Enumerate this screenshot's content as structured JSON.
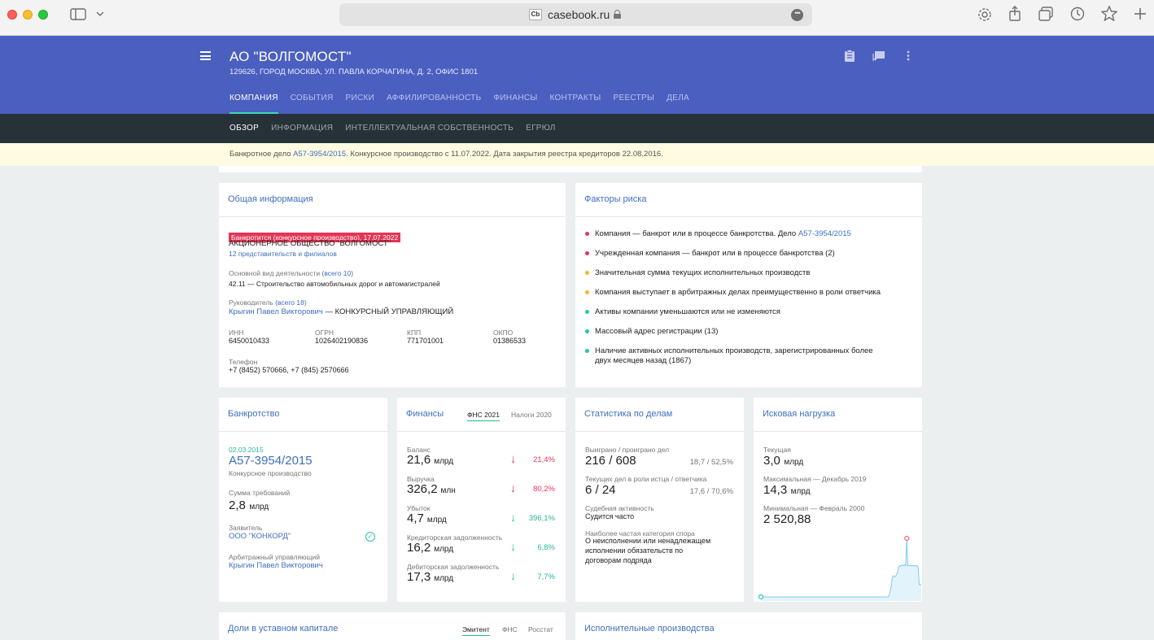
{
  "browser": {
    "url": "casebook.ru",
    "favicon_text": "Cb"
  },
  "company": {
    "name": "АО \"ВОЛГОМОСТ\"",
    "address": "129626, ГОРОД МОСКВА, УЛ. ПАВЛА КОРЧАГИНА, Д. 2, ОФИС 1801"
  },
  "main_tabs": [
    "КОМПАНИЯ",
    "СОБЫТИЯ",
    "РИСКИ",
    "АФФИЛИРОВАННОСТЬ",
    "ФИНАНСЫ",
    "КОНТРАКТЫ",
    "РЕЕСТРЫ",
    "ДЕЛА"
  ],
  "sub_tabs": [
    "ОБЗОР",
    "ИНФОРМАЦИЯ",
    "ИНТЕЛЛЕКТУАЛЬНАЯ СОБСТВЕННОСТЬ",
    "ЕГРЮЛ"
  ],
  "banner": {
    "prefix": "Банкротное дело ",
    "case_link": "А57-3954/2015",
    "suffix": ". Конкурсное производство с 11.07.2022. Дата закрытия реестра кредиторов 22.08.2016."
  },
  "general": {
    "title": "Общая информация",
    "badge": "Банкротится (конкурсное производство), 17.07.2022",
    "full_name": "АКЦИОНЕРНОЕ ОБЩЕСТВО \"ВОЛГОМОСТ\"",
    "branches": "12 представительств и филиалов",
    "activity_label": "Основной вид деятельности",
    "activity_total": "(всего 10)",
    "activity_value": "42.11 — Строительство автомобильных дорог и автомагистралей",
    "head_label": "Руководитель",
    "head_total": "(всего 18)",
    "head_name": "Крыгин Павел Викторович",
    "head_role": " — КОНКУРСНЫЙ УПРАВЛЯЮЩИЙ",
    "ids": [
      {
        "label": "ИНН",
        "value": "6450010433"
      },
      {
        "label": "ОГРН",
        "value": "1026402190836"
      },
      {
        "label": "КПП",
        "value": "771701001"
      },
      {
        "label": "ОКПО",
        "value": "01386533"
      }
    ],
    "phone_label": "Телефон",
    "phone_value": "+7 (8452) 570666, +7 (845) 2570666"
  },
  "risks": {
    "title": "Факторы риска",
    "items": [
      {
        "text": "Компания — банкрот или в процессе банкротства. Дело ",
        "link": "А57-3954/2015",
        "color": "#e53555"
      },
      {
        "text": "Учрежденная компания — банкрот или в процессе банкротства (2)",
        "link": "",
        "color": "#e53555"
      },
      {
        "text": "Значительная сумма текущих исполнительных производств",
        "link": "",
        "color": "#f5b72a"
      },
      {
        "text": "Компания выступает в арбитражных делах преимущественно в роли ответчика",
        "link": "",
        "color": "#f5b72a"
      },
      {
        "text": "Активы компании уменьшаются или не изменяются",
        "link": "",
        "color": "#26c6a6"
      },
      {
        "text": "Массовый адрес регистрации (13)",
        "link": "",
        "color": "#26c6a6"
      },
      {
        "text": "Наличие активных исполнительных производств, зарегистрированных более",
        "text2": "двух месяцев назад (1867)",
        "link": "",
        "color": "#26c6a6"
      }
    ]
  },
  "bankruptcy": {
    "title": "Банкротство",
    "date": "02.03.2015",
    "case": "А57-3954/2015",
    "proc": "Конкурсное производство",
    "claims_label": "Сумма требований",
    "claims_value": "2,8",
    "claims_unit": "млрд",
    "applicant_label": "Заявитель",
    "applicant_value": "ООО \"КОНКОРД\"",
    "manager_label": "Арбитражный управляющий",
    "manager_value": "Крыгин Павел Викторович"
  },
  "finance": {
    "title": "Финансы",
    "tab1": "ФНС 2021",
    "tab2": "Налоги 2020",
    "rows": [
      {
        "label": "Баланс",
        "value": "21,6",
        "unit": "млрд",
        "pct": "21,4%",
        "trend": "down-red"
      },
      {
        "label": "Выручка",
        "value": "326,2",
        "unit": "млн",
        "pct": "80,2%",
        "trend": "down-red"
      },
      {
        "label": "Убыток",
        "value": "4,7",
        "unit": "млрд",
        "pct": "396,1%",
        "trend": "down-green"
      },
      {
        "label": "Кредиторская задолженность",
        "value": "16,2",
        "unit": "млрд",
        "pct": "6,8%",
        "trend": "down-green"
      },
      {
        "label": "Дебиторская задолженность",
        "value": "17,3",
        "unit": "млрд",
        "pct": "7,7%",
        "trend": "down-green"
      }
    ]
  },
  "cases": {
    "title": "Статистика по делам",
    "won_label": "Выиграно / проиграно дел",
    "won_value": "216 / 608",
    "won_pct": "18,7 / 52,5%",
    "current_label": "Текущих дел в роли истца / ответчика",
    "current_value": "6 / 24",
    "current_pct": "17,6 / 70,6%",
    "activity_label": "Судебная активность",
    "activity_value": "Судится часто",
    "category_label": "Наиболее частая категория спора",
    "category_lines": [
      "О неисполнении или ненадлежащем",
      "исполнении обязательств по",
      "договорам подряда"
    ]
  },
  "claims": {
    "title": "Исковая нагрузка",
    "current_label": "Текущая",
    "current_value": "3,0",
    "current_unit": "млрд",
    "max_label": "Максимальная — Декабрь 2019",
    "max_value": "14,3",
    "max_unit": "млрд",
    "min_label": "Минимальная — Февраль 2000",
    "min_value": "2 520,88"
  },
  "shares": {
    "title": "Доли в уставном капитале",
    "tabs": [
      "Эмитент",
      "ФНС",
      "Росстат"
    ]
  },
  "enforcement": {
    "title": "Исполнительные производства"
  },
  "chart_data": {
    "type": "area",
    "title": "",
    "series": [
      {
        "values": [
          0.005,
          0.005,
          0.005,
          0.005,
          0.005,
          0.005,
          0.005,
          0.005,
          0.005,
          0.005,
          0.005,
          0.005,
          0.005,
          0.005,
          0.005,
          0.005,
          0.005,
          0.005,
          0.005,
          0.005,
          0.005,
          0.005,
          0.005,
          0.005,
          0.005,
          0.005,
          0.005,
          0.005,
          0.005,
          0.005,
          0.005,
          0.005,
          0.005,
          0.005,
          0.005,
          0.005,
          0.005,
          0.005,
          0.005,
          0.005,
          0.005,
          0.005,
          0.005,
          0.005,
          0.005,
          0.005,
          0.005,
          0.005,
          0.005,
          0.005,
          0.005,
          0.005,
          0.005,
          0.005,
          0.005,
          0.005,
          0.005,
          0.005,
          0.005,
          0.005,
          0.005,
          0.005,
          0.005,
          0.005,
          0.005,
          0.005,
          0.005,
          0.005,
          0.005,
          0.005,
          0.005,
          0.005,
          0.005,
          0.005,
          0.005,
          0.005,
          0.005,
          0.005,
          0.005,
          0.005,
          0.005,
          0.005,
          0.005,
          0.005,
          0.005,
          0.005,
          0.005,
          0.005,
          0.005,
          0.005,
          0.005,
          0.005,
          0.005,
          0.005,
          0.005,
          0.005,
          0.005,
          0.005,
          0.005,
          0.005,
          0.005,
          0.005,
          0.005,
          0.005,
          0.005,
          0.005,
          0.005,
          0.005,
          0.005,
          0.005,
          0.005,
          0.005,
          0.005,
          0.005,
          0.005,
          0.005,
          0.005,
          0.005,
          0.005,
          0.005,
          0.005,
          0.005,
          0.005,
          0.005,
          0.5,
          1.5,
          2.5,
          4.8,
          5.2,
          4.9,
          5.0,
          5.4,
          6.0,
          7.1,
          7.6,
          7.5,
          7.8,
          7.7,
          7.6,
          7.9,
          7.6,
          14.3,
          7.6,
          7.7,
          7.6,
          7.7,
          7.5,
          7.7,
          7.6,
          7.7,
          7.5,
          7.6,
          7.4,
          3.0,
          3.0,
          3.0
        ]
      }
    ],
    "max_point": {
      "label": "Декабрь 2019",
      "value": 14.3
    },
    "min_point": {
      "label": "Февраль 2000",
      "value": 0.0025
    }
  }
}
